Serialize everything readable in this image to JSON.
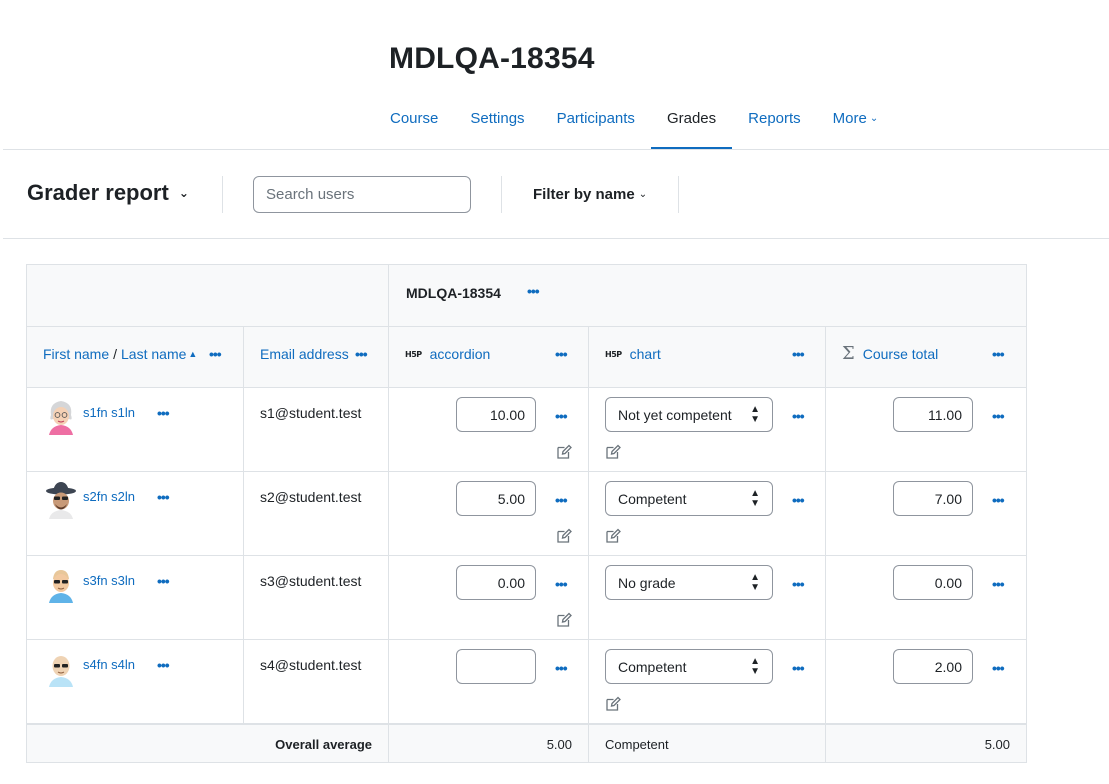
{
  "course": {
    "title": "MDLQA-18354"
  },
  "nav": {
    "items": [
      {
        "label": "Course"
      },
      {
        "label": "Settings"
      },
      {
        "label": "Participants"
      },
      {
        "label": "Grades",
        "active": true
      },
      {
        "label": "Reports"
      },
      {
        "label": "More"
      }
    ]
  },
  "actionbar": {
    "report_label": "Grader report",
    "search_placeholder": "Search users",
    "filter_label": "Filter by name"
  },
  "table": {
    "category": "MDLQA-18354",
    "headers": {
      "first_name": "First name",
      "name_sep": "/",
      "last_name": "Last name",
      "email": "Email address",
      "item1": "accordion",
      "item2": "chart",
      "total": "Course total",
      "h5p_badge": "H5P",
      "sigma": "Σ",
      "dots": "•••"
    },
    "rows": [
      {
        "name": "s1fn s1ln",
        "email": "s1@student.test",
        "accordion": "10.00",
        "chart": "Not yet competent",
        "total": "11.00"
      },
      {
        "name": "s2fn s2ln",
        "email": "s2@student.test",
        "accordion": "5.00",
        "chart": "Competent",
        "total": "7.00"
      },
      {
        "name": "s3fn s3ln",
        "email": "s3@student.test",
        "accordion": "0.00",
        "chart": "No grade",
        "total": "0.00"
      },
      {
        "name": "s4fn s4ln",
        "email": "s4@student.test",
        "accordion": "",
        "chart": "Competent",
        "total": "2.00"
      }
    ],
    "average": {
      "label": "Overall average",
      "accordion": "5.00",
      "chart": "Competent",
      "total": "5.00"
    }
  },
  "colors": {
    "link": "#0f6cbf",
    "border": "#dee2e6",
    "header_bg": "#f8f9fa",
    "text": "#1d2125"
  }
}
